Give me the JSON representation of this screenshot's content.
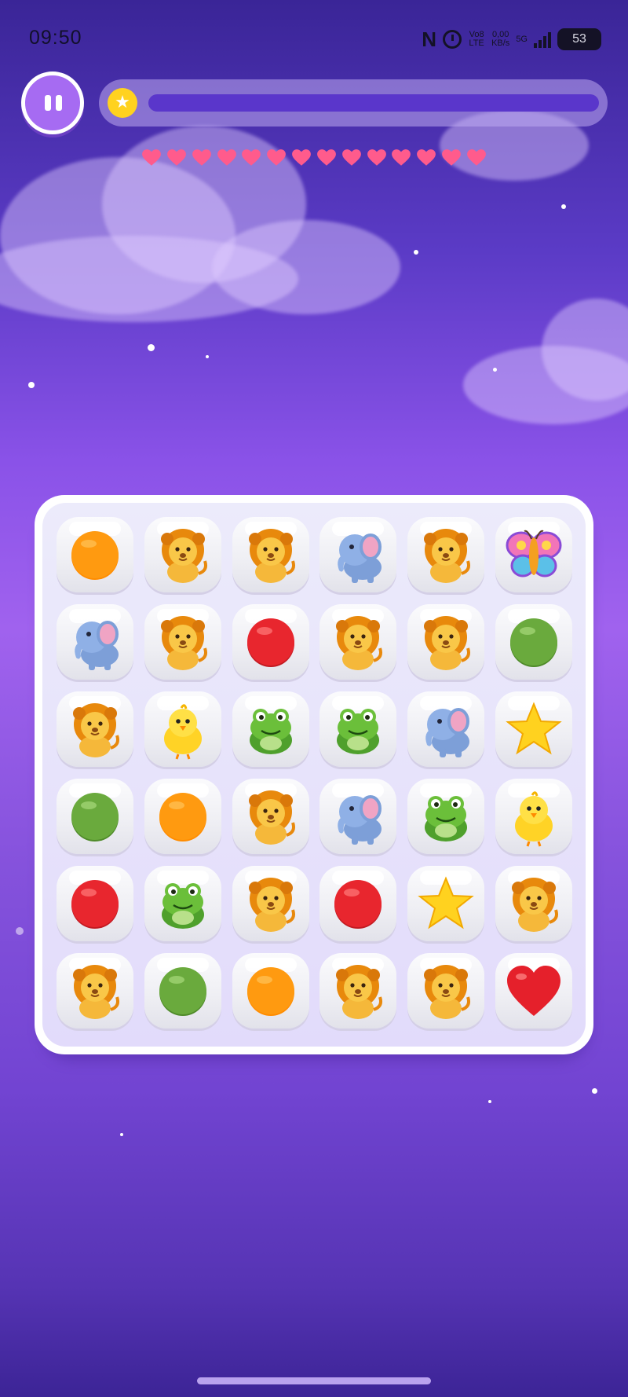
{
  "status_bar": {
    "time": "09:50",
    "network_type": "Vo8 LTE",
    "net_speed_value": "0,00",
    "net_speed_unit": "KB/s",
    "signal_type": "5G",
    "battery_level": "53"
  },
  "header": {
    "progress_fraction": 1.0,
    "lives": 14,
    "life_color": "#ff5b8c"
  },
  "board": {
    "rows": 6,
    "cols": 6,
    "tiles": [
      [
        "orange-ball",
        "lion",
        "lion",
        "elephant",
        "lion",
        "butterfly"
      ],
      [
        "elephant",
        "lion",
        "red-ball",
        "lion",
        "lion",
        "green-ball"
      ],
      [
        "lion",
        "chick",
        "frog",
        "frog",
        "elephant",
        "star"
      ],
      [
        "green-ball",
        "orange-ball",
        "lion",
        "elephant",
        "frog",
        "chick"
      ],
      [
        "red-ball",
        "frog",
        "lion",
        "red-ball",
        "star",
        "lion"
      ],
      [
        "lion",
        "green-ball",
        "orange-ball",
        "lion",
        "lion",
        "heart"
      ]
    ]
  },
  "colors": {
    "accent": "#a66bf2",
    "progress_fill": "#5a36cb",
    "orange": "#ff8c00",
    "red": "#e8262e",
    "green": "#6aaa3d",
    "star": "#ffd21f"
  }
}
